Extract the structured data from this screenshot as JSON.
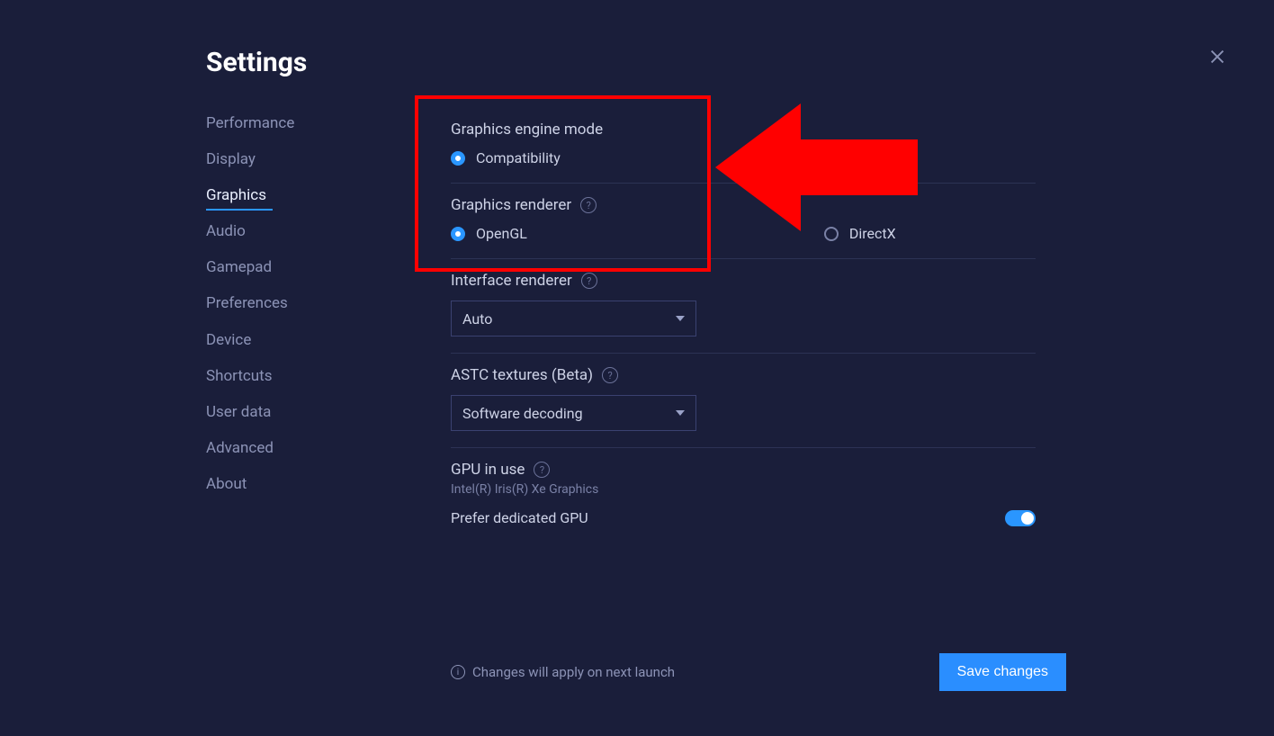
{
  "title": "Settings",
  "sidebar": {
    "items": [
      {
        "label": "Performance",
        "active": false
      },
      {
        "label": "Display",
        "active": false
      },
      {
        "label": "Graphics",
        "active": true
      },
      {
        "label": "Audio",
        "active": false
      },
      {
        "label": "Gamepad",
        "active": false
      },
      {
        "label": "Preferences",
        "active": false
      },
      {
        "label": "Device",
        "active": false
      },
      {
        "label": "Shortcuts",
        "active": false
      },
      {
        "label": "User data",
        "active": false
      },
      {
        "label": "Advanced",
        "active": false
      },
      {
        "label": "About",
        "active": false
      }
    ]
  },
  "graphics": {
    "engine_mode": {
      "label": "Graphics engine mode",
      "selected": "Compatibility",
      "options": [
        "Compatibility"
      ]
    },
    "renderer": {
      "label": "Graphics renderer",
      "selected": "OpenGL",
      "options": [
        "OpenGL",
        "DirectX"
      ]
    },
    "interface_renderer": {
      "label": "Interface renderer",
      "value": "Auto"
    },
    "astc": {
      "label": "ASTC textures (Beta)",
      "value": "Software decoding"
    },
    "gpu": {
      "label": "GPU in use",
      "value": "Intel(R) Iris(R) Xe Graphics",
      "prefer_label": "Prefer dedicated GPU",
      "prefer_on": true
    }
  },
  "footer": {
    "note": "Changes will apply on next launch",
    "save": "Save changes"
  }
}
